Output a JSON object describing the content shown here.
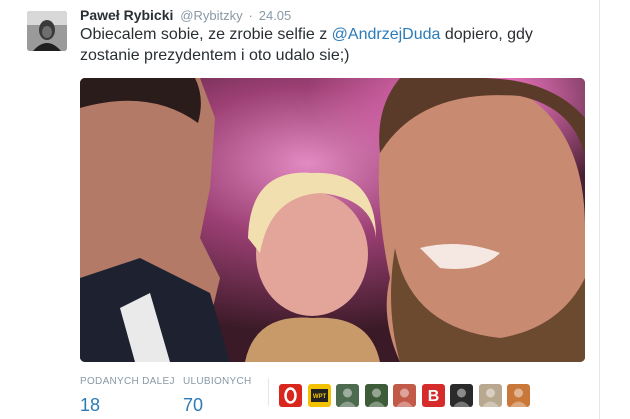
{
  "tweet": {
    "author_name": "Paweł Rybicki",
    "handle": "@Rybitzky",
    "separator": "·",
    "date": "24.05",
    "text_before": "Obiecalem sobie, ze zrobie selfie z ",
    "mention": "@AndrzejDuda",
    "text_after": " dopiero, gdy zostanie prezydentem i oto udalo sie;)"
  },
  "stats": {
    "retweets_label": "PODANYCH DALEJ",
    "retweets_value": "18",
    "likes_label": "ULUBIONYCH",
    "likes_value": "70"
  },
  "likers": [
    {
      "name": "liker-avatar-1",
      "color": "#d9271e",
      "text": "O"
    },
    {
      "name": "liker-avatar-2",
      "color": "#f2c200",
      "text": "WPT 1313"
    },
    {
      "name": "liker-avatar-3",
      "color": "#4d6b4f",
      "text": ""
    },
    {
      "name": "liker-avatar-4",
      "color": "#3f5c3a",
      "text": ""
    },
    {
      "name": "liker-avatar-5",
      "color": "#c25a4a",
      "text": ""
    },
    {
      "name": "liker-avatar-6",
      "color": "#d62b2b",
      "text": "B"
    },
    {
      "name": "liker-avatar-7",
      "color": "#2a2a2a",
      "text": ""
    },
    {
      "name": "liker-avatar-8",
      "color": "#b8a890",
      "text": ""
    },
    {
      "name": "liker-avatar-9",
      "color": "#c9783a",
      "text": ""
    }
  ],
  "colors": {
    "link": "#2b7bb9",
    "muted": "#8899a6",
    "text": "#292f33"
  }
}
